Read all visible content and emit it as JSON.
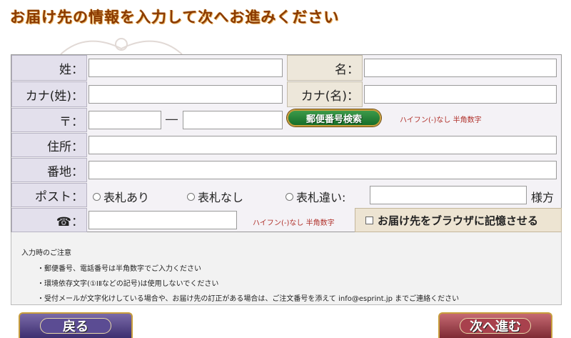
{
  "page_title": "お届け先の情報を入力して次へお進みください",
  "fields": {
    "last_name_label": "姓：",
    "first_name_label": "名：",
    "kana_last_label": "カナ(姓)：",
    "kana_first_label": "カナ(名)：",
    "postal_label": "〒：",
    "postal_dash": "―",
    "postal_search_button": "郵便番号検索",
    "postal_hint": "ハイフン(-)なし 半角数字",
    "address_label": "住所：",
    "street_label": "番地：",
    "post_label": "ポスト：",
    "post_options": [
      "表札あり",
      "表札なし",
      "表札違い:"
    ],
    "post_suffix": "様方",
    "phone_label": "☎：",
    "phone_hint": "ハイフン(-)なし 半角数字",
    "remember_label": "お届け先をブラウザに記憶させる"
  },
  "notes": {
    "heading": "入力時のご注意",
    "items": [
      "・郵便番号、電話番号は半角数字でご入力ください",
      "・環境依存文字(①ⅠⅡなどの記号)は使用しないでください",
      "・受付メールが文字化けしている場合や、お届け先の訂正がある場合は、ご注文番号を添えて info@esprint.jp までご連絡ください"
    ]
  },
  "nav": {
    "back_label": "戻る",
    "next_label": "次へ進む"
  }
}
